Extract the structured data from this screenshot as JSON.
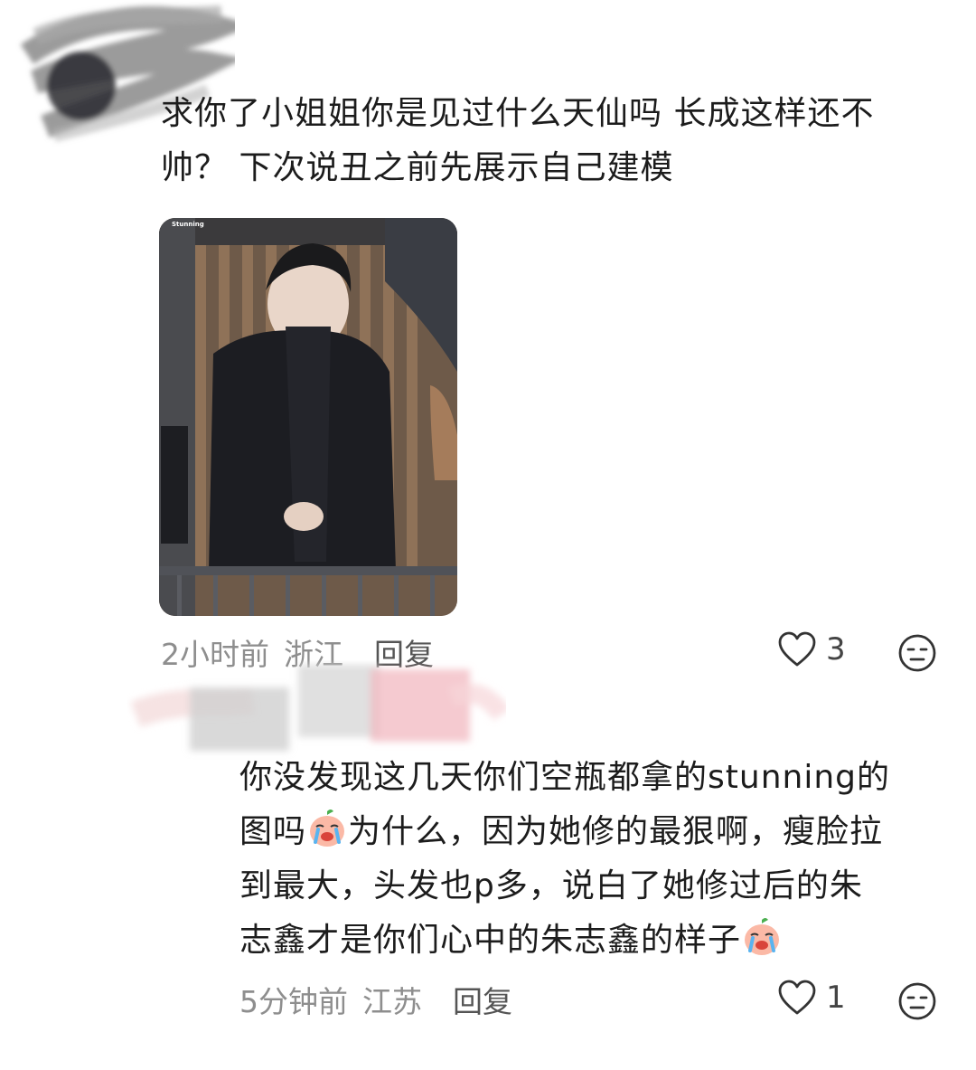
{
  "comments": [
    {
      "text_line1": "求你了小姐姐你是见过什么天仙吗 长成这样还不",
      "text_line2": "帅？ 下次说丑之前先展示自己建模",
      "photo_watermark": "Stunning",
      "time": "2小时前",
      "location": "浙江",
      "reply_label": "回复",
      "likes": "3"
    },
    {
      "text_line1": "你没发现这几天你们空瓶都拿的stunning的",
      "text_line2a": "图吗",
      "text_line2b": "为什么，因为她修的最狠啊，瘦脸拉",
      "text_line3": "到最大，头发也p多，说白了她修过后的朱",
      "text_line4": "志鑫才是你们心中的朱志鑫的样子",
      "time": "5分钟前",
      "location": "江苏",
      "reply_label": "回复",
      "likes": "1"
    }
  ],
  "icons": {
    "like": "heart-outline-icon",
    "reaction": "neutral-face-icon",
    "emoji": "crying-peach-emoji"
  },
  "colors": {
    "text": "#1c1c1c",
    "meta": "#8e8e8e",
    "icon": "#333333"
  }
}
